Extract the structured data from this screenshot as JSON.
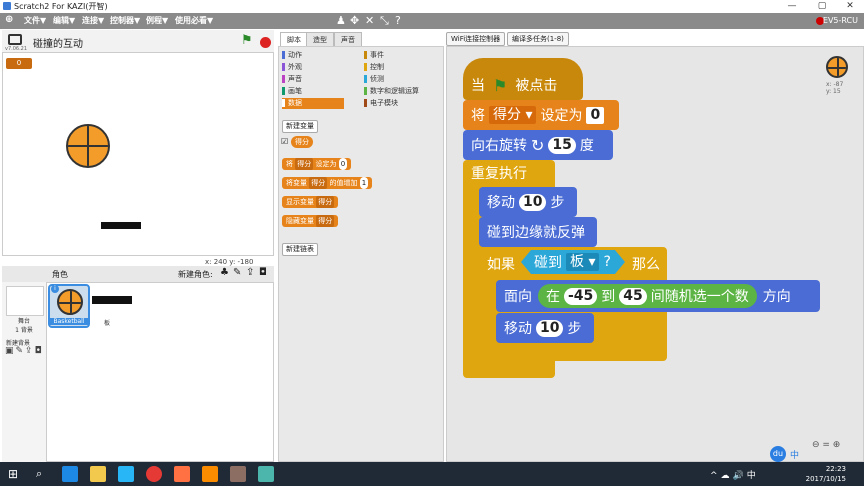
{
  "window": {
    "title": "Scratch2 For KAZI(开智)",
    "min": "—",
    "max": "▢",
    "close": "✕"
  },
  "menu": {
    "globe": "⊕",
    "items": [
      "文件▼",
      "编辑▼",
      "连接▼",
      "控制器▼",
      "例程▼",
      "使用必看▼"
    ],
    "tools": [
      "♟",
      "✥",
      "✕",
      "⤡",
      "?"
    ],
    "status_text": "EV5-RCU",
    "status_color": "#cc0000"
  },
  "stage": {
    "title": "碰撞的互动",
    "version": "v7.06.21",
    "green_flag": "⚑",
    "stop": "●",
    "variable_value": "0",
    "coords": "x: 240  y: -180"
  },
  "sprites": {
    "header_label": "角色",
    "new_sprite_label": "新建角色:",
    "stage_label": "舞台\n1 背景",
    "new_backdrop_label": "新建背景",
    "items": [
      {
        "name": "Basketball",
        "selected": true
      },
      {
        "name": "板",
        "selected": false
      }
    ]
  },
  "tabs": [
    "脚本",
    "造型",
    "声音"
  ],
  "categories": {
    "left": [
      {
        "label": "动作",
        "color": "#4a6cd4"
      },
      {
        "label": "外观",
        "color": "#8a55d7"
      },
      {
        "label": "声音",
        "color": "#bb42c3"
      },
      {
        "label": "画笔",
        "color": "#0e9a6c"
      },
      {
        "label": "数据",
        "color": "#e6831a",
        "active": true
      }
    ],
    "right": [
      {
        "label": "事件",
        "color": "#c8880b"
      },
      {
        "label": "控制",
        "color": "#e0a610"
      },
      {
        "label": "侦测",
        "color": "#2ba7d8"
      },
      {
        "label": "数字和逻辑运算",
        "color": "#5bb443"
      },
      {
        "label": "电子模块",
        "color": "#a04a1a"
      }
    ]
  },
  "palette": {
    "make_variable": "新建变量",
    "var_name": "得分",
    "set_block": "将",
    "set_block_var": "得分",
    "set_block_to": "设定为",
    "set_block_val": "0",
    "change_block": "将变量",
    "change_block_var": "得分",
    "change_block_by": "的值增加",
    "change_block_val": "1",
    "show_block": "显示变量",
    "show_block_var": "得分",
    "hide_block": "隐藏变量",
    "hide_block_var": "得分",
    "make_list": "新建链表"
  },
  "top_buttons": [
    "WiFi连接控制器",
    "编译多任务(1-8)"
  ],
  "script_sprite_coords": "x: -87\ny: 15",
  "script": {
    "when_flag": "当",
    "when_flag_tail": "被点击",
    "set_label": "将",
    "set_var": "得分",
    "set_to": "设定为",
    "set_val": "0",
    "turn_label": "向右旋转",
    "turn_val": "15",
    "turn_unit": "度",
    "forever_label": "重复执行",
    "move1_label": "移动",
    "move1_val": "10",
    "move1_unit": "步",
    "bounce_label": "碰到边缘就反弹",
    "if_label": "如果",
    "touching_label": "碰到",
    "touching_target": "板",
    "touching_q": "?",
    "then_label": "那么",
    "point_label": "面向",
    "random_in": "在",
    "random_from": "-45",
    "random_to_label": "到",
    "random_to": "45",
    "random_tail": "间随机选一个数",
    "point_tail": "方向",
    "move2_label": "移动",
    "move2_val": "10",
    "move2_unit": "步"
  },
  "taskbar": {
    "time": "22:23",
    "date": "2017/10/15",
    "ime": "中"
  }
}
